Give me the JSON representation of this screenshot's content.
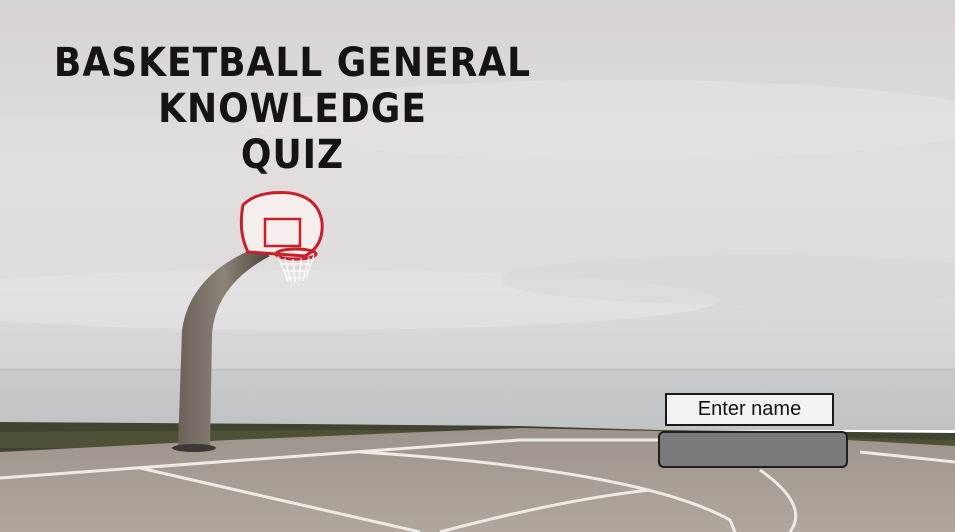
{
  "title": {
    "line1": "BASKETBALL GENERAL KNOWLEDGE",
    "line2": "QUIZ"
  },
  "name_entry": {
    "label": "Enter name",
    "value": "",
    "placeholder": ""
  },
  "colors": {
    "sky": "#dcd9d9",
    "sea": "#c4c7c9",
    "court": "#a49c93",
    "grass": "#3e4230",
    "hoop_rim": "#c8202a",
    "input_fill": "#7a7a7c"
  }
}
